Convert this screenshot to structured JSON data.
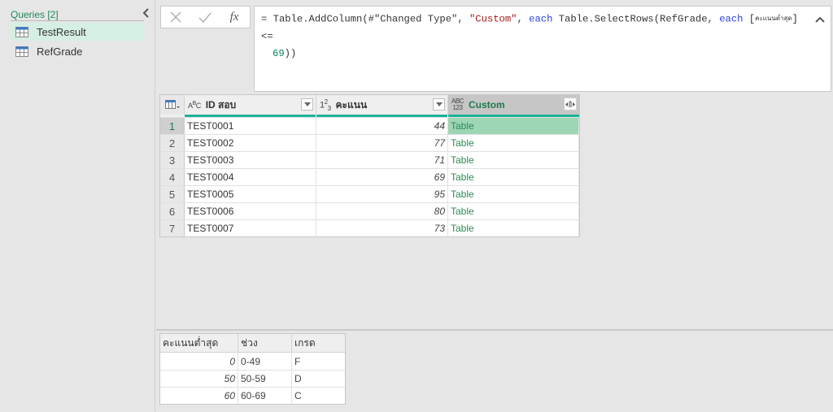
{
  "queries_pane": {
    "header": "Queries [2]",
    "items": [
      {
        "label": "TestResult",
        "icon": "table-icon",
        "selected": true
      },
      {
        "label": "RefGrade",
        "icon": "table-icon",
        "selected": false
      }
    ]
  },
  "formula_bar": {
    "cancel_icon": "✕",
    "commit_icon": "✓",
    "fx_label": "fx",
    "formula_parts": {
      "p1": "= Table.AddColumn(#\"Changed Type\", ",
      "p2": "\"Custom\"",
      "p3": ", ",
      "p4": "each",
      "p5": " Table.SelectRows(RefGrade, ",
      "p6": "each",
      "p7": " [",
      "p8": "คะแนนต่ำสุด",
      "p9": "] <=",
      "p10": "69",
      "p11": "))"
    }
  },
  "grid": {
    "columns": [
      {
        "type_icon": "ABC",
        "title": "ID สอบ"
      },
      {
        "type_icon": "123",
        "title": "คะแนน"
      },
      {
        "type_icon": "ABC123",
        "title": "Custom"
      }
    ],
    "rows": [
      {
        "n": "1",
        "id": "TEST0001",
        "score": "44",
        "custom": "Table"
      },
      {
        "n": "2",
        "id": "TEST0002",
        "score": "77",
        "custom": "Table"
      },
      {
        "n": "3",
        "id": "TEST0003",
        "score": "71",
        "custom": "Table"
      },
      {
        "n": "4",
        "id": "TEST0004",
        "score": "69",
        "custom": "Table"
      },
      {
        "n": "5",
        "id": "TEST0005",
        "score": "95",
        "custom": "Table"
      },
      {
        "n": "6",
        "id": "TEST0006",
        "score": "80",
        "custom": "Table"
      },
      {
        "n": "7",
        "id": "TEST0007",
        "score": "73",
        "custom": "Table"
      }
    ],
    "selected_row": 1
  },
  "preview": {
    "columns": [
      "คะแนนต่ำสุด",
      "ช่วง",
      "เกรด"
    ],
    "rows": [
      [
        "0",
        "0-49",
        "F"
      ],
      [
        "50",
        "50-59",
        "D"
      ],
      [
        "60",
        "60-69",
        "C"
      ]
    ]
  },
  "colors": {
    "accent_green": "#1e8a5a",
    "teal_bar": "#1bb39a",
    "selected_cell": "#9dd6b4",
    "selected_query": "#d6efe3"
  }
}
